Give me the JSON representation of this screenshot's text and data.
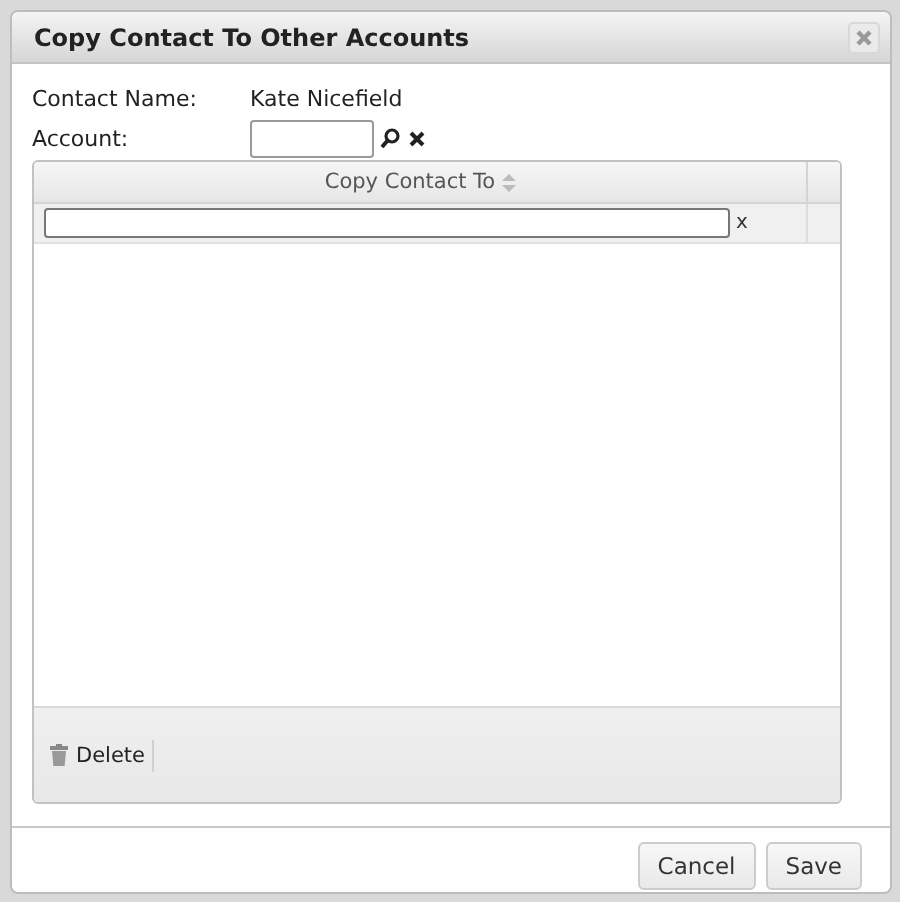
{
  "dialog": {
    "title": "Copy Contact To Other Accounts"
  },
  "fields": [
    {
      "kind": "text",
      "label": "Contact Name:",
      "value": "Kate Nicefield"
    },
    {
      "kind": "lookup",
      "label": "Account:"
    }
  ],
  "grid": {
    "columns": [
      {
        "label": "Copy Contact To",
        "sortable": true
      }
    ],
    "filter_clear": "x",
    "toolbar": [
      {
        "label": "Delete"
      }
    ]
  },
  "buttons": [
    {
      "label": "Cancel"
    },
    {
      "label": "Save"
    }
  ]
}
